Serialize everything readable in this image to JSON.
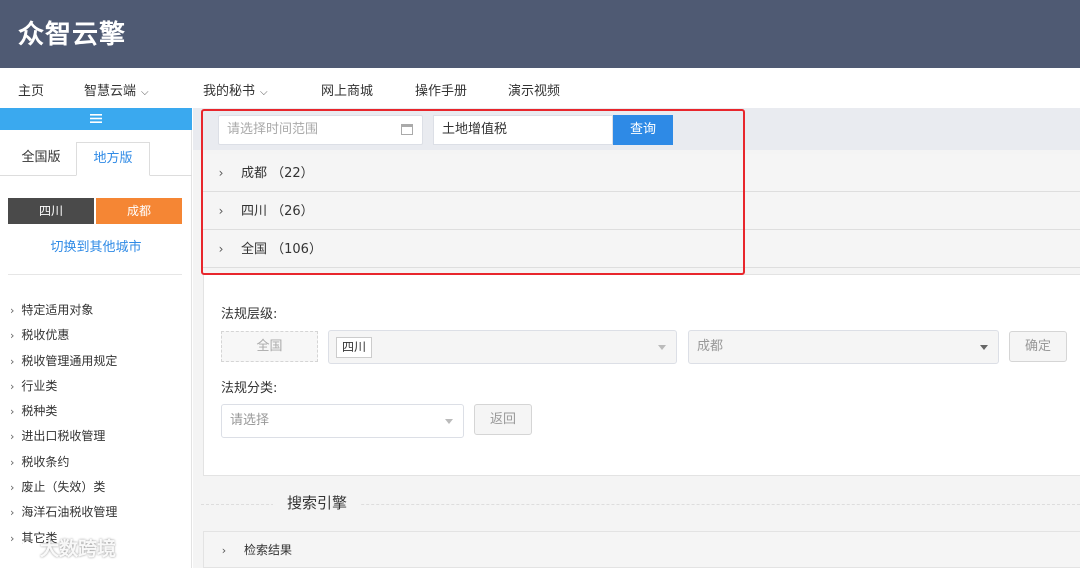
{
  "app": {
    "logo": "众智云擎"
  },
  "nav": {
    "items": [
      {
        "label": "主页",
        "chevron": ""
      },
      {
        "label": "智慧云端",
        "chevron": "⌵"
      },
      {
        "label": "我的秘书",
        "chevron": "⌵"
      },
      {
        "label": "网上商城",
        "chevron": ""
      },
      {
        "label": "操作手册",
        "chevron": ""
      },
      {
        "label": "演示视频",
        "chevron": ""
      }
    ]
  },
  "sidebar": {
    "toggle_icon": "menu-icon",
    "tabs": [
      "全国版",
      "地方版"
    ],
    "regions": [
      "四川",
      "成都"
    ],
    "switch_city": "切换到其他城市",
    "categories": [
      "特定适用对象",
      "税收优惠",
      "税收管理通用规定",
      "行业类",
      "税种类",
      "进出口税收管理",
      "税收条约",
      "废止（失效）类",
      "海洋石油税收管理",
      "其它类"
    ]
  },
  "search": {
    "date_placeholder": "请选择时间范围",
    "keyword": "土地增值税",
    "query_label": "查询"
  },
  "results": [
    {
      "label": "成都 （22）"
    },
    {
      "label": "四川 （26）"
    },
    {
      "label": "全国 （106）"
    }
  ],
  "filters": {
    "level_label": "法规层级:",
    "national_btn": "全国",
    "province_tag": "四川",
    "city_placeholder": "成都",
    "confirm": "确定",
    "category_label": "法规分类:",
    "category_placeholder": "请选择",
    "back": "返回"
  },
  "engine": {
    "title": "搜索引擎",
    "result_header": "检索结果"
  },
  "watermark": "大数跨境",
  "colors": {
    "topbar": "#4f5a73",
    "accent": "#2e8ae6",
    "orange": "#f58634",
    "highlight": "#e8262c"
  }
}
